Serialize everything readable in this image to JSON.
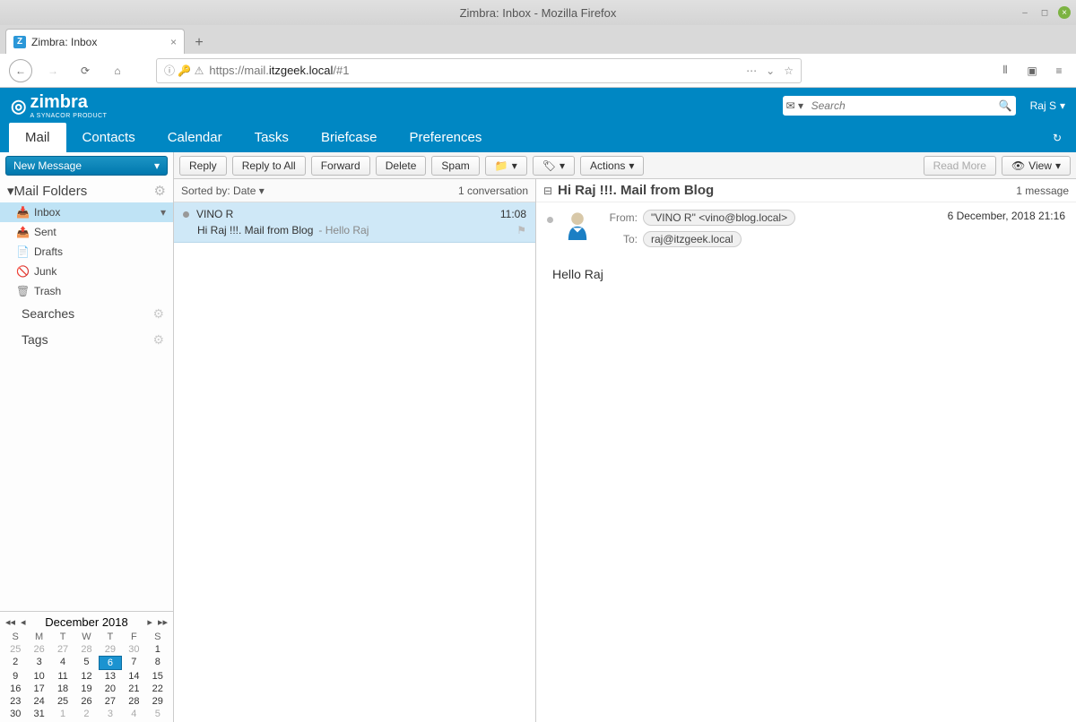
{
  "window": {
    "title": "Zimbra: Inbox - Mozilla Firefox"
  },
  "browser": {
    "tab_title": "Zimbra: Inbox",
    "url_prefix": "https://mail.",
    "url_domain": "itzgeek.local",
    "url_suffix": "/#1"
  },
  "header": {
    "brand": "zimbra",
    "brand_sub": "A SYNACOR PRODUCT",
    "search_placeholder": "Search",
    "user": "Raj S"
  },
  "tabs": {
    "mail": "Mail",
    "contacts": "Contacts",
    "calendar": "Calendar",
    "tasks": "Tasks",
    "briefcase": "Briefcase",
    "preferences": "Preferences"
  },
  "sidebar": {
    "new_message": "New Message",
    "folders_header": "Mail Folders",
    "folders": {
      "inbox": "Inbox",
      "sent": "Sent",
      "drafts": "Drafts",
      "junk": "Junk",
      "trash": "Trash"
    },
    "searches": "Searches",
    "tags": "Tags"
  },
  "toolbar": {
    "reply": "Reply",
    "reply_all": "Reply to All",
    "forward": "Forward",
    "delete": "Delete",
    "spam": "Spam",
    "actions": "Actions",
    "read_more": "Read More",
    "view": "View"
  },
  "list": {
    "sorted_by": "Sorted by: Date",
    "count": "1 conversation",
    "item": {
      "sender": "VINO R",
      "time": "11:08",
      "subject": "Hi Raj !!!. Mail from Blog",
      "preview": "- Hello Raj"
    }
  },
  "pane": {
    "subject": "Hi Raj !!!. Mail from Blog",
    "count": "1 message",
    "from_label": "From:",
    "from_value": "\"VINO R\" <vino@blog.local>",
    "to_label": "To:",
    "to_value": "raj@itzgeek.local",
    "date": "6 December, 2018 21:16",
    "body": "Hello Raj"
  },
  "calendar": {
    "title": "December 2018",
    "day_headers": [
      "S",
      "M",
      "T",
      "W",
      "T",
      "F",
      "S"
    ],
    "weeks": [
      [
        {
          "d": "25",
          "o": true
        },
        {
          "d": "26",
          "o": true
        },
        {
          "d": "27",
          "o": true
        },
        {
          "d": "28",
          "o": true
        },
        {
          "d": "29",
          "o": true
        },
        {
          "d": "30",
          "o": true
        },
        {
          "d": "1"
        }
      ],
      [
        {
          "d": "2"
        },
        {
          "d": "3"
        },
        {
          "d": "4"
        },
        {
          "d": "5"
        },
        {
          "d": "6",
          "t": true
        },
        {
          "d": "7"
        },
        {
          "d": "8"
        }
      ],
      [
        {
          "d": "9"
        },
        {
          "d": "10"
        },
        {
          "d": "11"
        },
        {
          "d": "12"
        },
        {
          "d": "13"
        },
        {
          "d": "14"
        },
        {
          "d": "15"
        }
      ],
      [
        {
          "d": "16"
        },
        {
          "d": "17"
        },
        {
          "d": "18"
        },
        {
          "d": "19"
        },
        {
          "d": "20"
        },
        {
          "d": "21"
        },
        {
          "d": "22"
        }
      ],
      [
        {
          "d": "23"
        },
        {
          "d": "24"
        },
        {
          "d": "25"
        },
        {
          "d": "26"
        },
        {
          "d": "27"
        },
        {
          "d": "28"
        },
        {
          "d": "29"
        }
      ],
      [
        {
          "d": "30"
        },
        {
          "d": "31"
        },
        {
          "d": "1",
          "o": true
        },
        {
          "d": "2",
          "o": true
        },
        {
          "d": "3",
          "o": true
        },
        {
          "d": "4",
          "o": true
        },
        {
          "d": "5",
          "o": true
        }
      ]
    ]
  }
}
